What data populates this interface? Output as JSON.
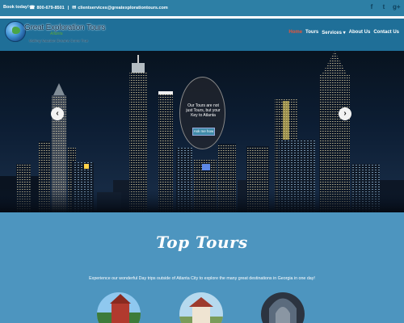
{
  "topbar": {
    "book_label": "Book today!",
    "phone": "800-679-8501",
    "email": "clientservices@greatexplorationtours.com",
    "social": [
      "f",
      "t",
      "g+"
    ]
  },
  "brand": {
    "name": "Great Exploration Tours",
    "sub": "Atlanta",
    "tagline": "Making Vacation Dreams Come True"
  },
  "nav": {
    "items": [
      "Home",
      "Tours",
      "Services",
      "About Us",
      "Contact Us"
    ],
    "active": "Home",
    "services_caret": "▾"
  },
  "hero": {
    "bubble_text": "Our Tours are not just Tours, but your Key to Atlanta",
    "bubble_button": "Ask me how",
    "prev_arrow": "‹",
    "next_arrow": "›"
  },
  "tours": {
    "heading": "Top Tours",
    "description": "Experience our wonderful Day trips outside of Atlanta City to explore the many great destinations in Georgia in one day!"
  },
  "colors": {
    "topbar": "#2d7fa5",
    "navbar": "#1f6f98",
    "accent_active": "#e8543a",
    "section_bg": "#4d95bf"
  },
  "icons": {
    "phone": "phone-icon",
    "email": "envelope-icon",
    "facebook": "facebook-icon",
    "twitter": "twitter-icon",
    "google_plus": "google-plus-icon"
  }
}
